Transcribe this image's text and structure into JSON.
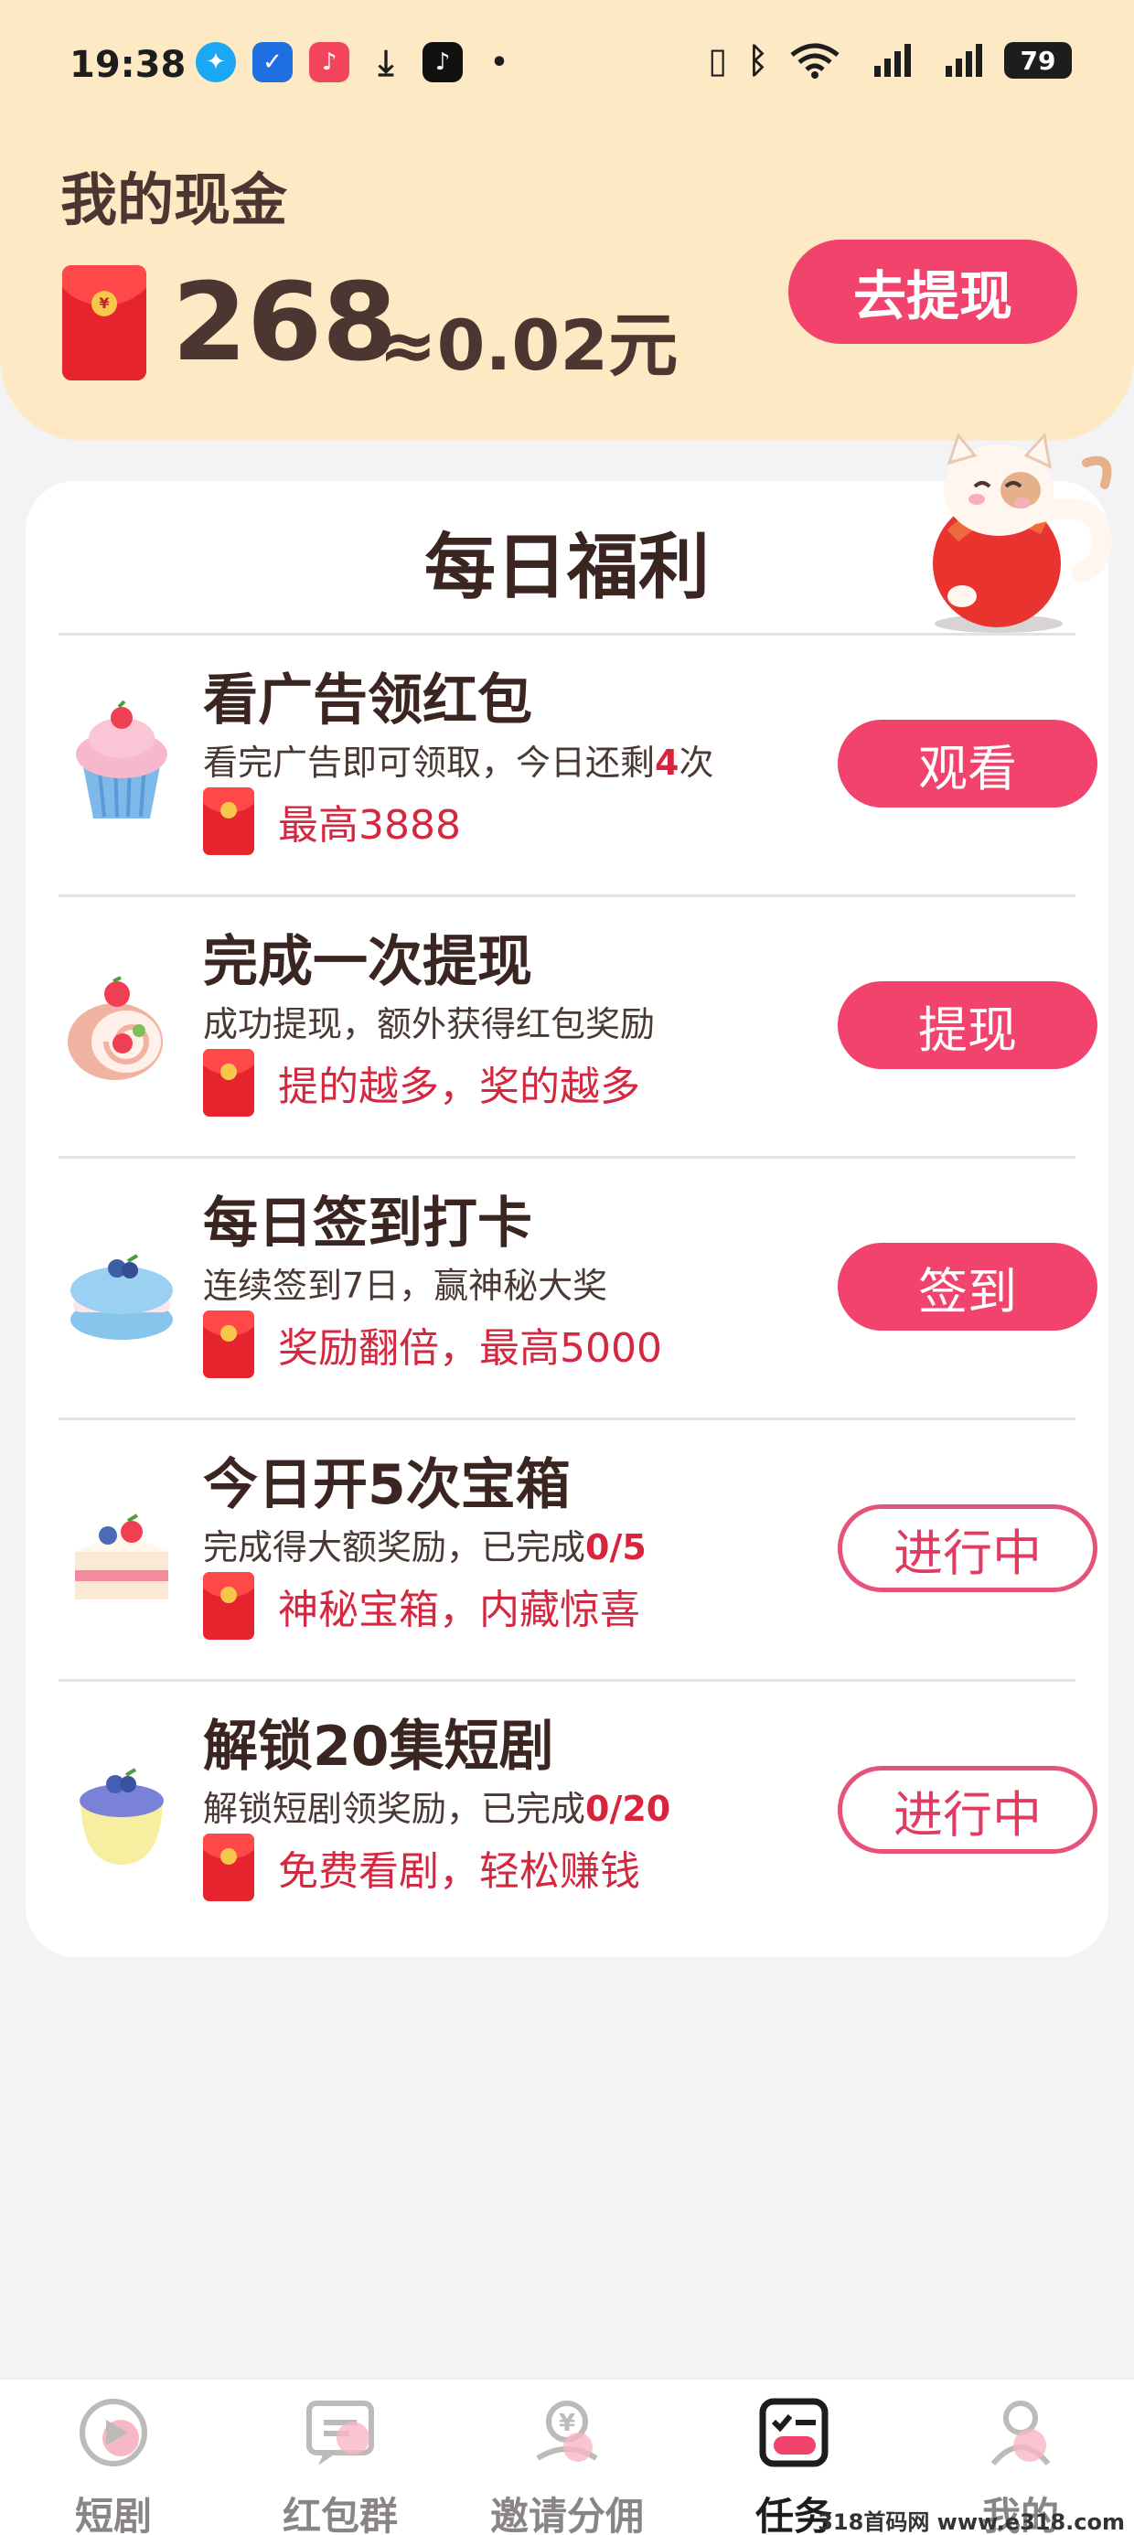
{
  "status_bar": {
    "time": "19:38",
    "battery": "79"
  },
  "header": {
    "title": "我的现金",
    "amount": "268",
    "equiv": "≈0.02元",
    "withdraw_label": "去提现"
  },
  "card": {
    "title": "每日福利",
    "tasks": [
      {
        "title": "看广告领红包",
        "desc_before": "看完广告即可领取，今日还剩",
        "desc_highlight": "4",
        "desc_after": "次",
        "reward": "最高3888",
        "button": "观看",
        "button_style": "solid",
        "icon": "cupcake-icon"
      },
      {
        "title": "完成一次提现",
        "desc_before": "成功提现，额外获得红包奖励",
        "desc_highlight": "",
        "desc_after": "",
        "reward": "提的越多，奖的越多",
        "button": "提现",
        "button_style": "solid",
        "icon": "swiss-roll-icon"
      },
      {
        "title": "每日签到打卡",
        "desc_before": "连续签到7日，赢神秘大奖",
        "desc_highlight": "",
        "desc_after": "",
        "reward": "奖励翻倍，最高5000",
        "button": "签到",
        "button_style": "solid",
        "icon": "macaron-icon"
      },
      {
        "title": "今日开5次宝箱",
        "desc_before": "完成得大额奖励，已完成",
        "desc_highlight": "0/5",
        "desc_after": "",
        "reward": "神秘宝箱，内藏惊喜",
        "button": "进行中",
        "button_style": "outline",
        "icon": "cake-slice-icon"
      },
      {
        "title": "解锁20集短剧",
        "desc_before": "解锁短剧领奖励，已完成",
        "desc_highlight": "0/20",
        "desc_after": "",
        "reward": "免费看剧，轻松赚钱",
        "button": "进行中",
        "button_style": "outline",
        "icon": "pudding-icon"
      }
    ]
  },
  "bottom_nav": {
    "items": [
      {
        "label": "短剧",
        "icon": "play-icon"
      },
      {
        "label": "红包群",
        "icon": "chat-icon"
      },
      {
        "label": "邀请分佣",
        "icon": "invite-coin-icon"
      },
      {
        "label": "任务",
        "icon": "task-list-icon",
        "active": true
      },
      {
        "label": "我的",
        "icon": "profile-icon"
      }
    ]
  },
  "watermark": "318首码网 www.e318.com",
  "colors": {
    "accent": "#f1436c",
    "header_bg": "#fde9c3",
    "reward_red": "#d3283f"
  }
}
